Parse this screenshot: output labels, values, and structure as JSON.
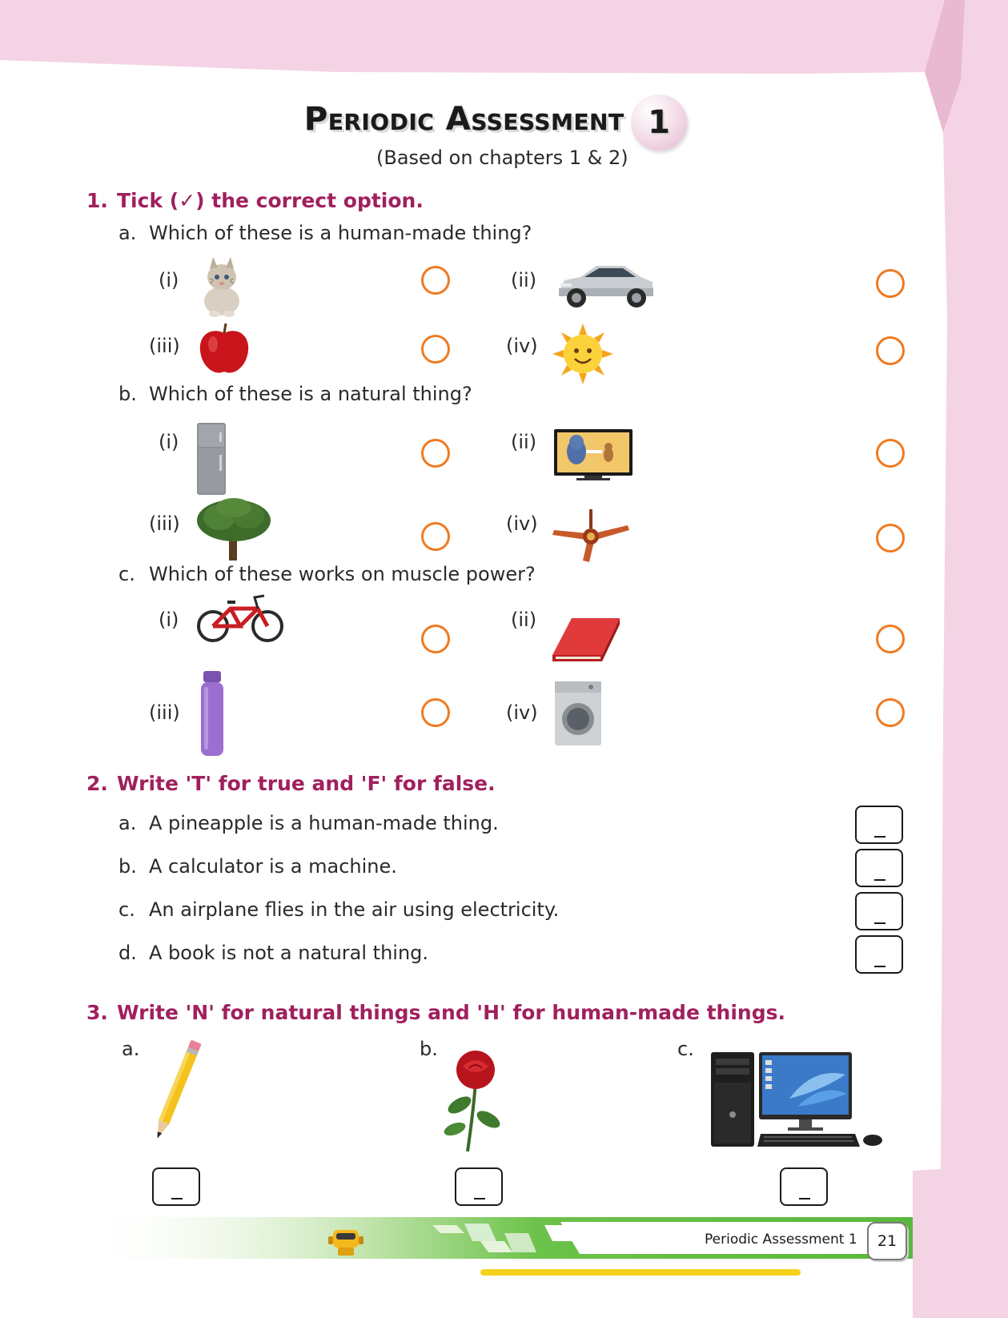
{
  "header": {
    "title": "Periodic Assessment",
    "badge": "1",
    "subtitle": "(Based on chapters 1 & 2)"
  },
  "q1": {
    "number": "1.",
    "heading": "Tick (✓) the correct option.",
    "parts": [
      {
        "letter": "a.",
        "question": "Which of these is a human-made thing?",
        "options": [
          {
            "label": "(i)",
            "icon": "kitten-icon"
          },
          {
            "label": "(ii)",
            "icon": "car-icon"
          },
          {
            "label": "(iii)",
            "icon": "apple-icon"
          },
          {
            "label": "(iv)",
            "icon": "sun-icon"
          }
        ]
      },
      {
        "letter": "b.",
        "question": "Which of these is a natural thing?",
        "options": [
          {
            "label": "(i)",
            "icon": "refrigerator-icon"
          },
          {
            "label": "(ii)",
            "icon": "television-icon"
          },
          {
            "label": "(iii)",
            "icon": "tree-icon"
          },
          {
            "label": "(iv)",
            "icon": "ceiling-fan-icon"
          }
        ]
      },
      {
        "letter": "c.",
        "question": "Which of these works on muscle power?",
        "options": [
          {
            "label": "(i)",
            "icon": "bicycle-icon"
          },
          {
            "label": "(ii)",
            "icon": "book-icon"
          },
          {
            "label": "(iii)",
            "icon": "water-bottle-icon"
          },
          {
            "label": "(iv)",
            "icon": "washing-machine-icon"
          }
        ]
      }
    ]
  },
  "q2": {
    "number": "2.",
    "heading": "Write 'T' for true and 'F' for false.",
    "statements": [
      {
        "letter": "a.",
        "text": "A pineapple is a human-made thing."
      },
      {
        "letter": "b.",
        "text": "A calculator is a machine."
      },
      {
        "letter": "c.",
        "text": "An airplane flies in the air using electricity."
      },
      {
        "letter": "d.",
        "text": "A book is not a natural thing."
      }
    ]
  },
  "q3": {
    "number": "3.",
    "heading": "Write 'N' for natural things and 'H' for human-made things.",
    "items": [
      {
        "letter": "a.",
        "icon": "pencil-icon"
      },
      {
        "letter": "b.",
        "icon": "rose-icon"
      },
      {
        "letter": "c.",
        "icon": "desktop-computer-icon"
      }
    ]
  },
  "footer": {
    "text": "Periodic Assessment 1",
    "page_number": "21"
  },
  "colors": {
    "heading": "#a0205e",
    "circle": "#f07a20",
    "pink_bg": "#f4d3e4",
    "footer_green": "#6cc24a"
  }
}
